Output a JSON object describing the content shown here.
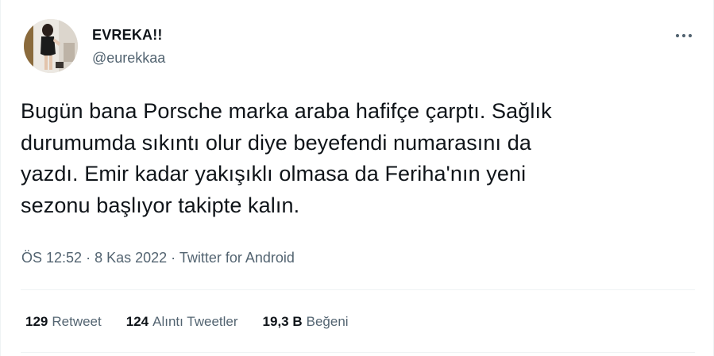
{
  "author": {
    "display_name": "EVREKA!!",
    "handle": "@eurekkaa"
  },
  "tweet": {
    "text": "Bugün bana Porsche marka araba hafifçe çarptı. Sağlık\ndurumumda sıkıntı olur diye beyefendi numarasını da\nyazdı. Emir kadar yakışıklı olmasa da Feriha'nın yeni\nsezonu başlıyor takipte kalın.",
    "time": "ÖS 12:52",
    "separator": " · ",
    "date": "8 Kas 2022",
    "source": "Twitter for Android"
  },
  "stats": [
    {
      "count": "129",
      "label": "Retweet"
    },
    {
      "count": "124",
      "label": "Alıntı Tweetler"
    },
    {
      "count": "19,3 B",
      "label": "Beğeni"
    }
  ],
  "icons": {
    "more": "more-horizontal-icon"
  },
  "colors": {
    "text_primary": "#0f1419",
    "text_secondary": "#536471",
    "divider": "#eff3f4"
  }
}
